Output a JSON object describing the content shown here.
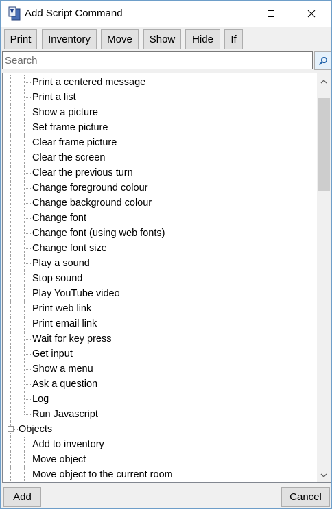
{
  "window": {
    "title": "Add Script Command",
    "controls": {
      "minimize": "minimize",
      "maximize": "maximize",
      "close": "close"
    }
  },
  "toolbar": {
    "buttons": [
      "Print",
      "Inventory",
      "Move",
      "Show",
      "Hide",
      "If"
    ]
  },
  "search": {
    "placeholder": "Search",
    "value": ""
  },
  "tree": {
    "items": [
      "Print a centered message",
      "Print a list",
      "Show a picture",
      "Set frame picture",
      "Clear frame picture",
      "Clear the screen",
      "Clear the previous turn",
      "Change foreground colour",
      "Change background colour",
      "Change font",
      "Change font (using web fonts)",
      "Change font size",
      "Play a sound",
      "Stop sound",
      "Play YouTube video",
      "Print web link",
      "Print email link",
      "Wait for key press",
      "Get input",
      "Show a menu",
      "Ask a question",
      "Log",
      "Run Javascript"
    ],
    "group_objects": {
      "label": "Objects",
      "expanded": true,
      "items": [
        "Add to inventory",
        "Move object",
        "Move object to the current room"
      ]
    }
  },
  "footer": {
    "add_label": "Add",
    "cancel_label": "Cancel"
  },
  "icons": {
    "app": "quest-app-icon",
    "search": "search-icon",
    "scroll_up": "chevron-up-icon",
    "scroll_down": "chevron-down-icon",
    "expander": "collapse-icon"
  },
  "colors": {
    "window_border": "#6e9ec9",
    "button_face": "#e1e1e1",
    "button_border": "#adadad",
    "search_button_face": "#e5f1fb",
    "scroll_thumb": "#cdcdcd",
    "tree_line": "#a0a0a0"
  }
}
